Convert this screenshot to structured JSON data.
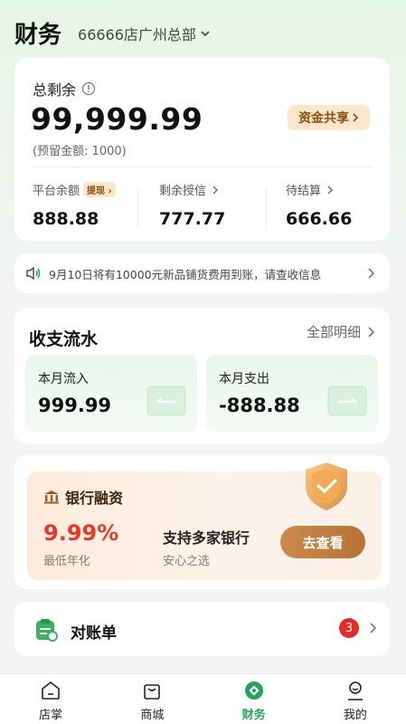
{
  "header": {
    "title": "财务",
    "store": "66666店广州总部"
  },
  "balance": {
    "label": "总剩余",
    "amount": "99,999.99",
    "reserve": "(预留金额: 1000)",
    "share_label": "资金共享",
    "stats": [
      {
        "label": "平台余额",
        "tag": "提现",
        "value": "888.88"
      },
      {
        "label": "剩余授信",
        "value": "777.77"
      },
      {
        "label": "待结算",
        "value": "666.66"
      }
    ]
  },
  "notice": {
    "text": "9月10日将有10000元新品铺货费用到账，请查收信息"
  },
  "flow": {
    "title": "收支流水",
    "all_label": "全部明细",
    "income": {
      "label": "本月流入",
      "value": "999.99"
    },
    "expense": {
      "label": "本月支出",
      "value": "-888.88"
    }
  },
  "loan": {
    "title": "银行融资",
    "rate": "9.99%",
    "rate_label": "最低年化",
    "support": "支持多家银行",
    "support_sub": "安心之选",
    "button": "去查看"
  },
  "statement": {
    "label": "对账单",
    "badge": "3"
  },
  "tabbar": {
    "items": [
      {
        "label": "店掌",
        "icon": "home-icon"
      },
      {
        "label": "商城",
        "icon": "shopping-bag-icon"
      },
      {
        "label": "财务",
        "icon": "finance-icon",
        "active": true
      },
      {
        "label": "我的",
        "icon": "user-icon"
      }
    ]
  },
  "colors": {
    "accent": "#25a45a",
    "rate_red": "#e23a2b",
    "gold": "#b87238"
  }
}
